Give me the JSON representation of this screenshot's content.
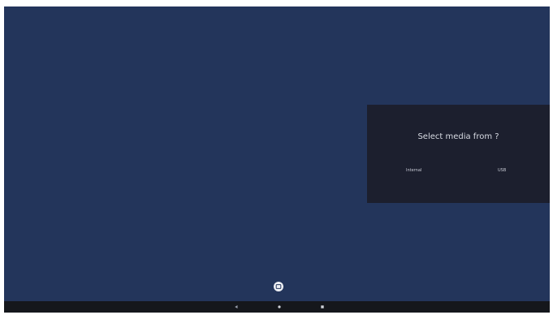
{
  "dialog": {
    "title": "Select media from ?",
    "options": {
      "internal_label": "Internal",
      "usb_label": "USB"
    }
  },
  "floating_button": {
    "icon": "window-icon"
  },
  "navigation_bar": {
    "back_icon": "back-triangle-icon",
    "home_icon": "home-circle-icon",
    "recents_icon": "recents-square-icon"
  },
  "colors": {
    "background": "#23355b",
    "dialog": "#1c1f2e",
    "navbar": "#15171c"
  }
}
